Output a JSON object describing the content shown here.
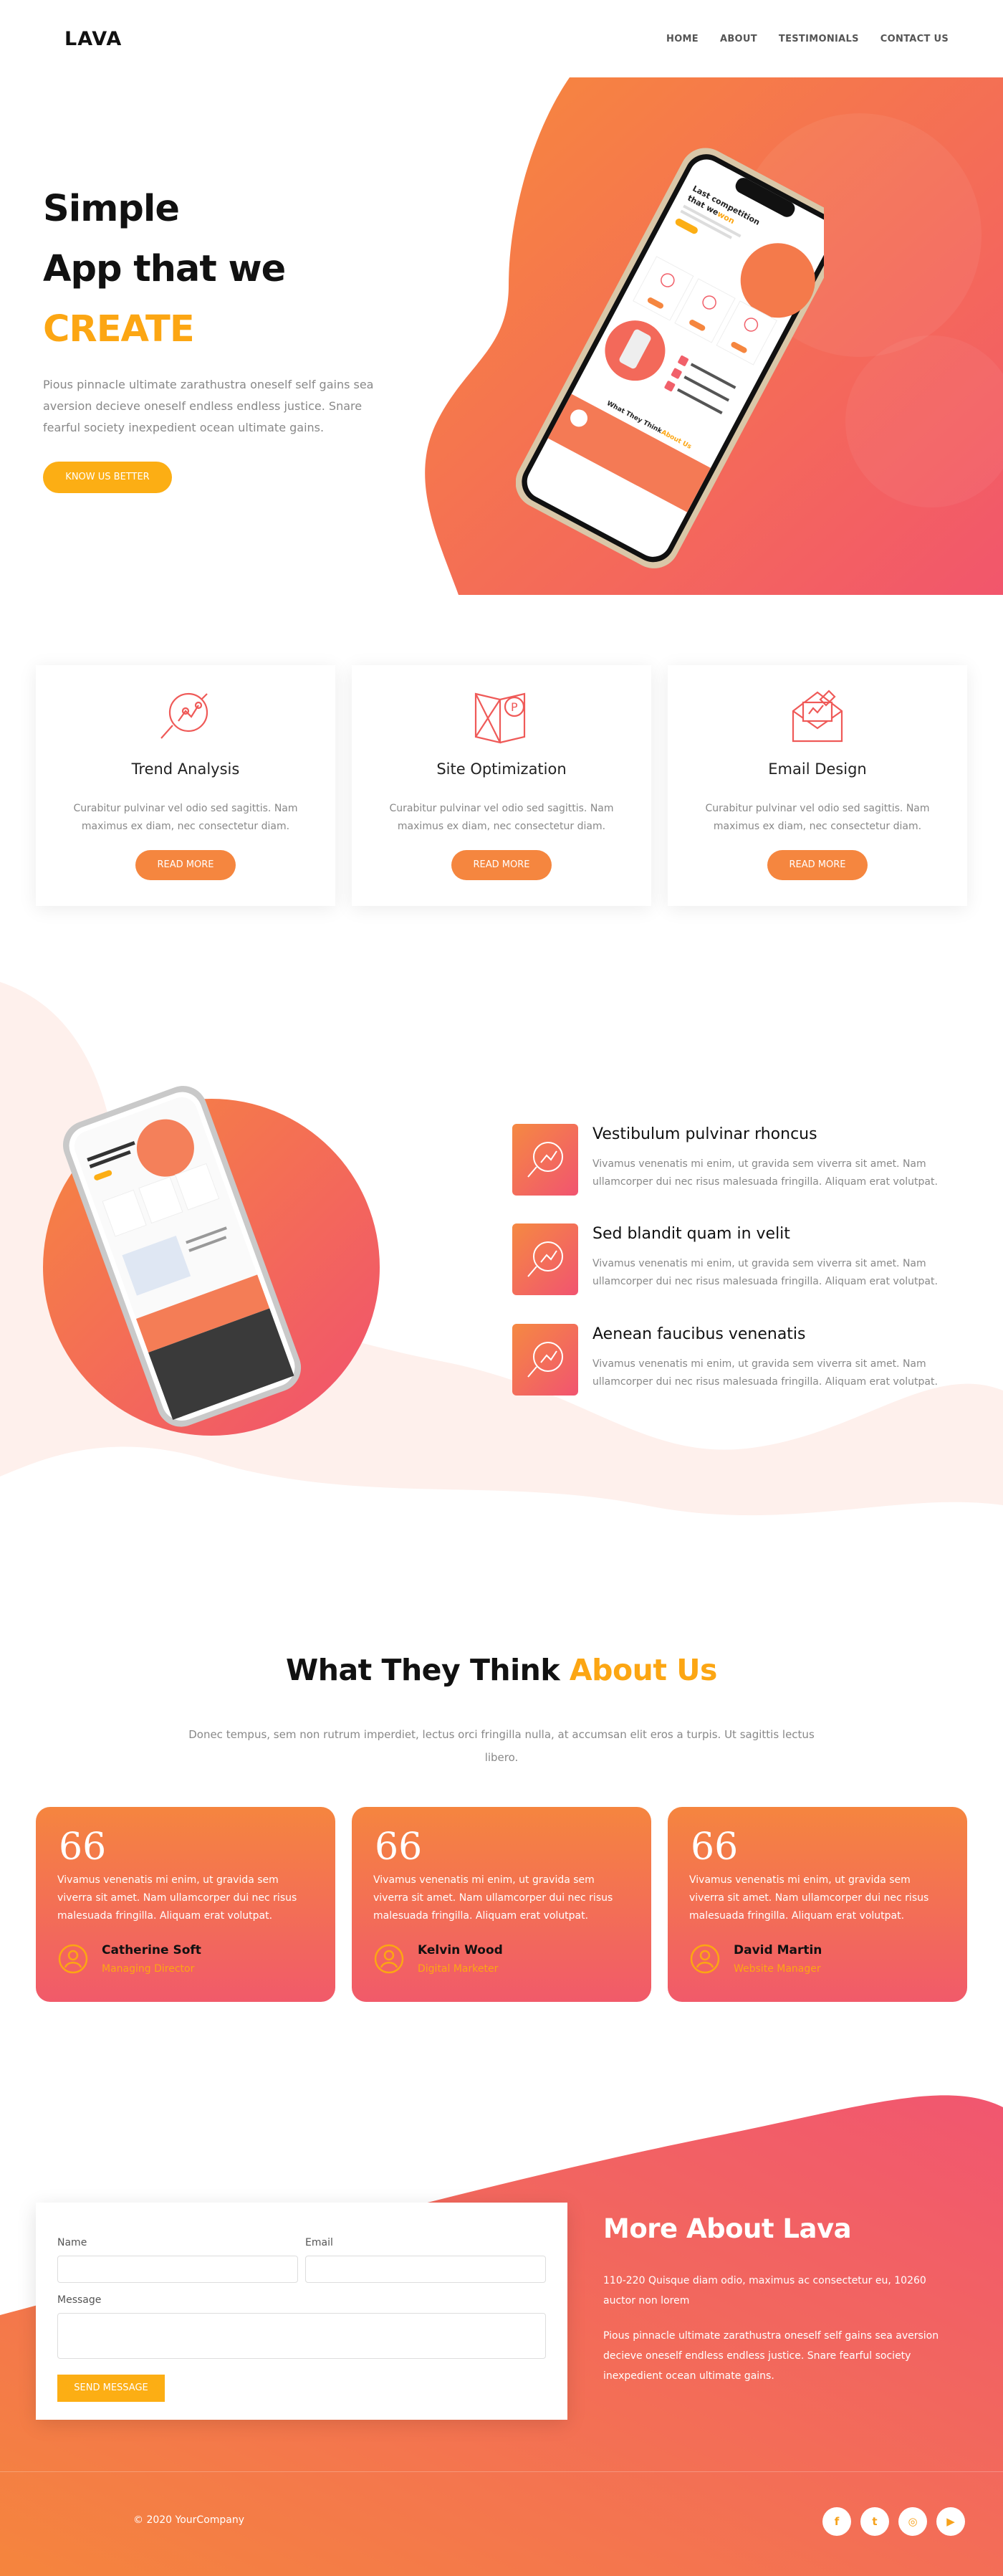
{
  "nav": {
    "logo": "LAVA",
    "links": [
      "HOME",
      "ABOUT",
      "TESTIMONIALS",
      "CONTACT US"
    ]
  },
  "hero": {
    "line1": "Simple",
    "line2": "App that we",
    "line3": "CREATE",
    "description": "Pious pinnacle ultimate zarathustra oneself self gains sea aversion decieve oneself endless endless justice. Snare fearful society inexpedient ocean ultimate gains.",
    "button": "KNOW US BETTER",
    "phone_heading_1": "Last competition",
    "phone_heading_2": "that we",
    "phone_heading_accent": "won",
    "phone_footer_text": "What They Think",
    "phone_footer_accent": "About Us"
  },
  "services": [
    {
      "title": "Trend Analysis",
      "text": "Curabitur pulvinar vel odio sed sagittis. Nam maximus ex diam, nec consectetur diam.",
      "button": "READ MORE"
    },
    {
      "title": "Site Optimization",
      "text": "Curabitur pulvinar vel odio sed sagittis. Nam maximus ex diam, nec consectetur diam.",
      "button": "READ MORE"
    },
    {
      "title": "Email Design",
      "text": "Curabitur pulvinar vel odio sed sagittis. Nam maximus ex diam, nec consectetur diam.",
      "button": "READ MORE"
    }
  ],
  "features": [
    {
      "title": "Vestibulum pulvinar rhoncus",
      "text": "Vivamus venenatis mi enim, ut gravida sem viverra sit amet. Nam ullamcorper dui nec risus malesuada fringilla. Aliquam erat volutpat."
    },
    {
      "title": "Sed blandit quam in velit",
      "text": "Vivamus venenatis mi enim, ut gravida sem viverra sit amet. Nam ullamcorper dui nec risus malesuada fringilla. Aliquam erat volutpat."
    },
    {
      "title": "Aenean faucibus venenatis",
      "text": "Vivamus venenatis mi enim, ut gravida sem viverra sit amet. Nam ullamcorper dui nec risus malesuada fringilla. Aliquam erat volutpat."
    }
  ],
  "testimonials": {
    "title": "What They Think",
    "title_accent": "About Us",
    "description": "Donec tempus, sem non rutrum imperdiet, lectus orci fringilla nulla, at accumsan elit eros a turpis. Ut sagittis lectus libero.",
    "quote_mark": "66",
    "items": [
      {
        "text": "Vivamus venenatis mi enim, ut gravida sem viverra sit amet. Nam ullamcorper dui nec risus malesuada fringilla. Aliquam erat volutpat.",
        "name": "Catherine Soft",
        "role": "Managing Director"
      },
      {
        "text": "Vivamus venenatis mi enim, ut gravida sem viverra sit amet. Nam ullamcorper dui nec risus malesuada fringilla. Aliquam erat volutpat.",
        "name": "Kelvin Wood",
        "role": "Digital Marketer"
      },
      {
        "text": "Vivamus venenatis mi enim, ut gravida sem viverra sit amet. Nam ullamcorper dui nec risus malesuada fringilla. Aliquam erat volutpat.",
        "name": "David Martin",
        "role": "Website Manager"
      }
    ]
  },
  "contact": {
    "name_label": "Name",
    "email_label": "Email",
    "message_label": "Message",
    "send_button": "SEND MESSAGE"
  },
  "about": {
    "title": "More About Lava",
    "p1": "110-220 Quisque diam odio, maximus ac consectetur eu, 10260 auctor non lorem",
    "p2": "Pious pinnacle ultimate zarathustra oneself self gains sea aversion decieve oneself endless endless justice. Snare fearful society inexpedient ocean ultimate gains."
  },
  "footer": {
    "copyright": "© 2020 YourCompany",
    "social_icons": [
      "facebook-icon",
      "twitter-icon",
      "instagram-icon",
      "youtube-icon"
    ],
    "social_glyphs": [
      "f",
      "t",
      "◎",
      "▶"
    ]
  },
  "colors": {
    "accent_yellow": "#fca613",
    "orange": "#f5863f",
    "pink": "#f15470"
  }
}
